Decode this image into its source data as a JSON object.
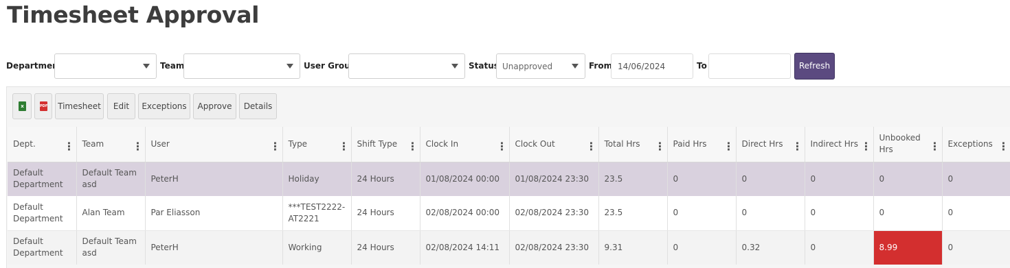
{
  "page": {
    "title": "Timesheet Approval"
  },
  "filters": {
    "department": {
      "label": "Department",
      "value": ""
    },
    "team": {
      "label": "Team",
      "value": ""
    },
    "user_group": {
      "label": "User Group",
      "value": ""
    },
    "status": {
      "label": "Status",
      "value": "Unapproved"
    },
    "from": {
      "label": "From",
      "value": "14/06/2024"
    },
    "to": {
      "label": "To",
      "value": ""
    },
    "refresh_label": "Refresh"
  },
  "toolbar": {
    "excel_icon": "excel-file-icon",
    "pdf_icon": "pdf-file-icon",
    "timesheet": "Timesheet",
    "edit": "Edit",
    "exceptions": "Exceptions",
    "approve": "Approve",
    "details": "Details"
  },
  "grid": {
    "columns": [
      "Dept.",
      "Team",
      "User",
      "Type",
      "Shift Type",
      "Clock In",
      "Clock Out",
      "Total Hrs",
      "Paid Hrs",
      "Direct Hrs",
      "Indirect Hrs",
      "Unbooked Hrs",
      "Exceptions"
    ],
    "menu_glyph": "⋮",
    "rows": [
      [
        "Default Department",
        "Default Team asd",
        "PeterH",
        "Holiday",
        "24 Hours",
        "01/08/2024 00:00",
        "01/08/2024 23:30",
        "23.5",
        "0",
        "0",
        "0",
        "0",
        "0"
      ],
      [
        "Default Department",
        "Alan Team",
        "Par Eliasson",
        "***TEST2222-AT2221",
        "24 Hours",
        "02/08/2024 00:00",
        "02/08/2024 23:30",
        "23.5",
        "0",
        "0",
        "0",
        "0",
        "0"
      ],
      [
        "Default Department",
        "Default Team asd",
        "PeterH",
        "Working",
        "24 Hours",
        "02/08/2024 14:11",
        "02/08/2024 23:30",
        "9.31",
        "0",
        "0.32",
        "0",
        "8.99",
        "0"
      ]
    ]
  },
  "colors": {
    "accent": "#5b4a80",
    "selected_row": "#d9d1de",
    "alert": "#d32f2f"
  }
}
